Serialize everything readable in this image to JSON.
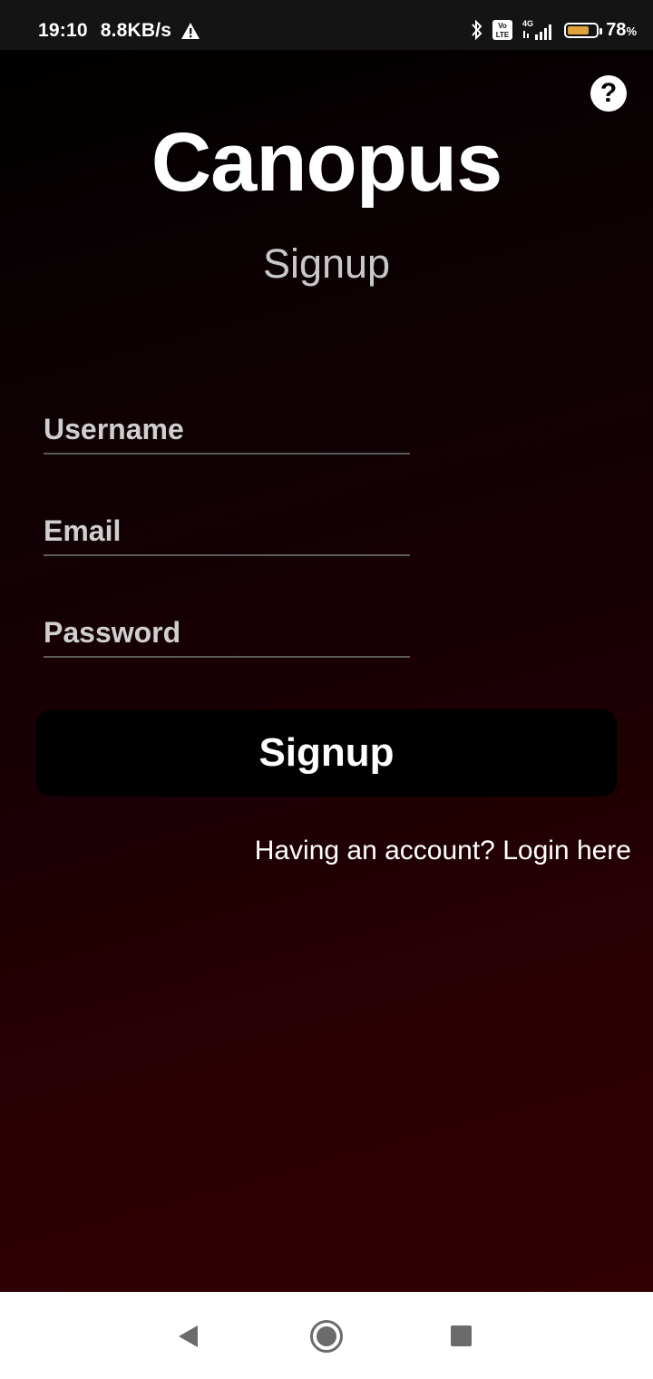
{
  "status_bar": {
    "time": "19:10",
    "network_speed": "8.8KB/s",
    "warning_icon": "warning-triangle-icon",
    "bluetooth_icon": "bluetooth-icon",
    "volte_label": "Vo LTE",
    "network_type": "4G",
    "battery_percent": "78",
    "battery_unit": "%",
    "battery_level": 0.78,
    "battery_color": "#e0a23a"
  },
  "header": {
    "help_label": "?",
    "app_title": "Canopus",
    "subtitle": "Signup"
  },
  "form": {
    "username_placeholder": "Username",
    "email_placeholder": "Email",
    "password_placeholder": "Password",
    "signup_label": "Signup",
    "login_link": "Having an account? Login here"
  },
  "nav_bar": {
    "back_icon": "back-triangle-icon",
    "home_icon": "home-circle-icon",
    "recents_icon": "recents-square-icon"
  },
  "colors": {
    "background_top": "#000000",
    "background_bottom": "#300003",
    "button_bg": "#000000",
    "text": "#ffffff"
  }
}
